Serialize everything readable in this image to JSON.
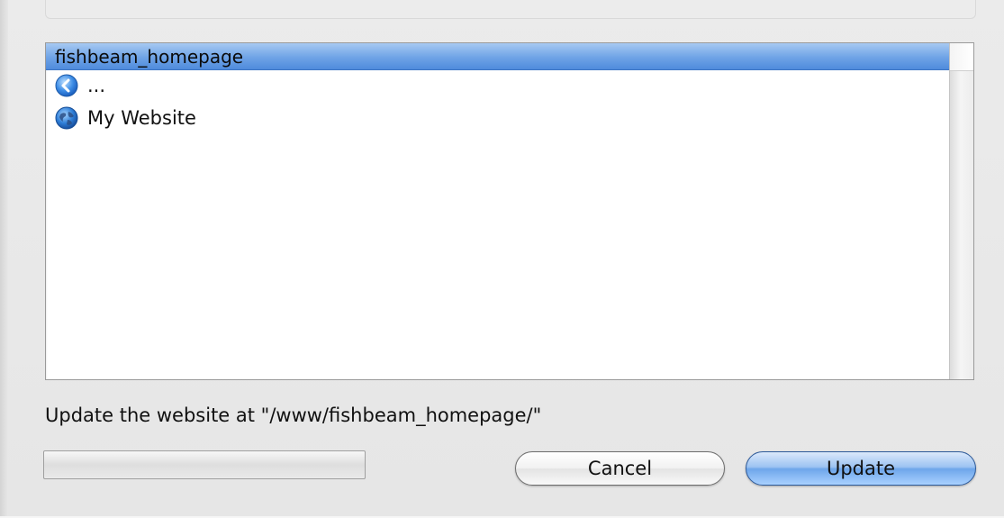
{
  "list": {
    "header": "fishbeam_homepage",
    "items": [
      {
        "icon": "back-arrow-icon",
        "label": "..."
      },
      {
        "icon": "globe-icon",
        "label": "My Website"
      }
    ]
  },
  "status": {
    "text": "Update the website at \"/www/fishbeam_homepage/\"",
    "progress": 0
  },
  "buttons": {
    "cancel": "Cancel",
    "update": "Update"
  },
  "colors": {
    "selection": "#6ea3e6",
    "default_button": "#6ea6ea"
  }
}
